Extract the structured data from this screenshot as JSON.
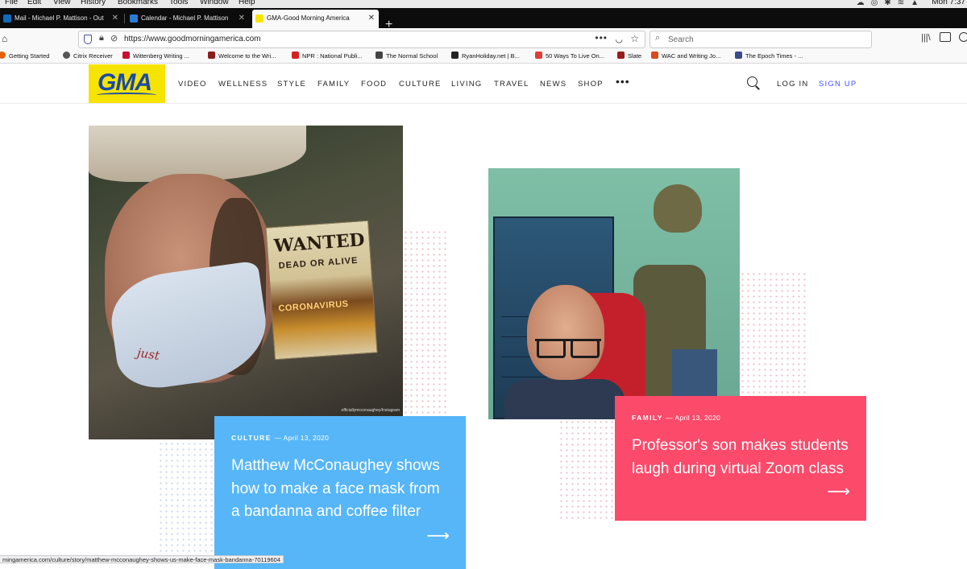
{
  "menubar": {
    "items": [
      "File",
      "Edit",
      "View",
      "History",
      "Bookmarks",
      "Tools",
      "Window",
      "Help"
    ],
    "clock": "Mon 7:37"
  },
  "tabs": [
    {
      "title": "Mail - Michael P. Mattison - Out",
      "favicon_color": "#0f6cbd"
    },
    {
      "title": "Calendar - Michael P. Mattison",
      "favicon_color": "#2b7cd3"
    },
    {
      "title": "GMA-Good Morning America",
      "favicon_color": "#f6e400"
    }
  ],
  "navbar": {
    "url": "https://www.goodmorningamerica.com",
    "search_placeholder": "Search"
  },
  "bookmarks": [
    {
      "label": "Getting Started",
      "color": "#e66000"
    },
    {
      "label": "Citrix Receiver",
      "color": "#555555"
    },
    {
      "label": "Wittenberg Writing ...",
      "color": "#c8102e"
    },
    {
      "label": "Welcome to the Wri...",
      "color": "#8b1d1d"
    },
    {
      "label": "NPR : National Publi...",
      "color": "#d62021"
    },
    {
      "label": "The Normal School",
      "color": "#444444"
    },
    {
      "label": "RyanHoliday.net | B...",
      "color": "#222222"
    },
    {
      "label": "50 Ways To Live On...",
      "color": "#e03e36"
    },
    {
      "label": "Slate",
      "color": "#9b1b1b"
    },
    {
      "label": "WAC and Writing Jo...",
      "color": "#d94a1e"
    },
    {
      "label": "The Epoch Times - ...",
      "color": "#3a4a8a"
    }
  ],
  "site": {
    "logo": "GMA",
    "nav": [
      "VIDEO",
      "WELLNESS",
      "STYLE",
      "FAMILY",
      "FOOD",
      "CULTURE",
      "LIVING",
      "TRAVEL",
      "NEWS",
      "SHOP"
    ],
    "more": "•••",
    "login": "LOG IN",
    "signup": "SIGN UP"
  },
  "articles": [
    {
      "category": "CULTURE",
      "date": "— April 13, 2020",
      "headline": "Matthew McConaughey shows how to make a face mask from a bandanna and coffee filter",
      "color": "#56b6f8",
      "image_credit": "officiallymcconaughey/Instagram",
      "poster_line1": "WANTED",
      "poster_line2": "DEAD OR ALIVE",
      "poster_line3": "CORONAVIRUS",
      "mask_text": "just"
    },
    {
      "category": "FAMILY",
      "date": "— April 13, 2020",
      "headline": "Professor's son makes students laugh during virtual Zoom class",
      "color": "#fc4a6a"
    }
  ],
  "statusbar": {
    "url": "mingamerica.com/culture/story/matthew-mcconaughey-shows-us-make-face-mask-bandanna-70119604"
  }
}
